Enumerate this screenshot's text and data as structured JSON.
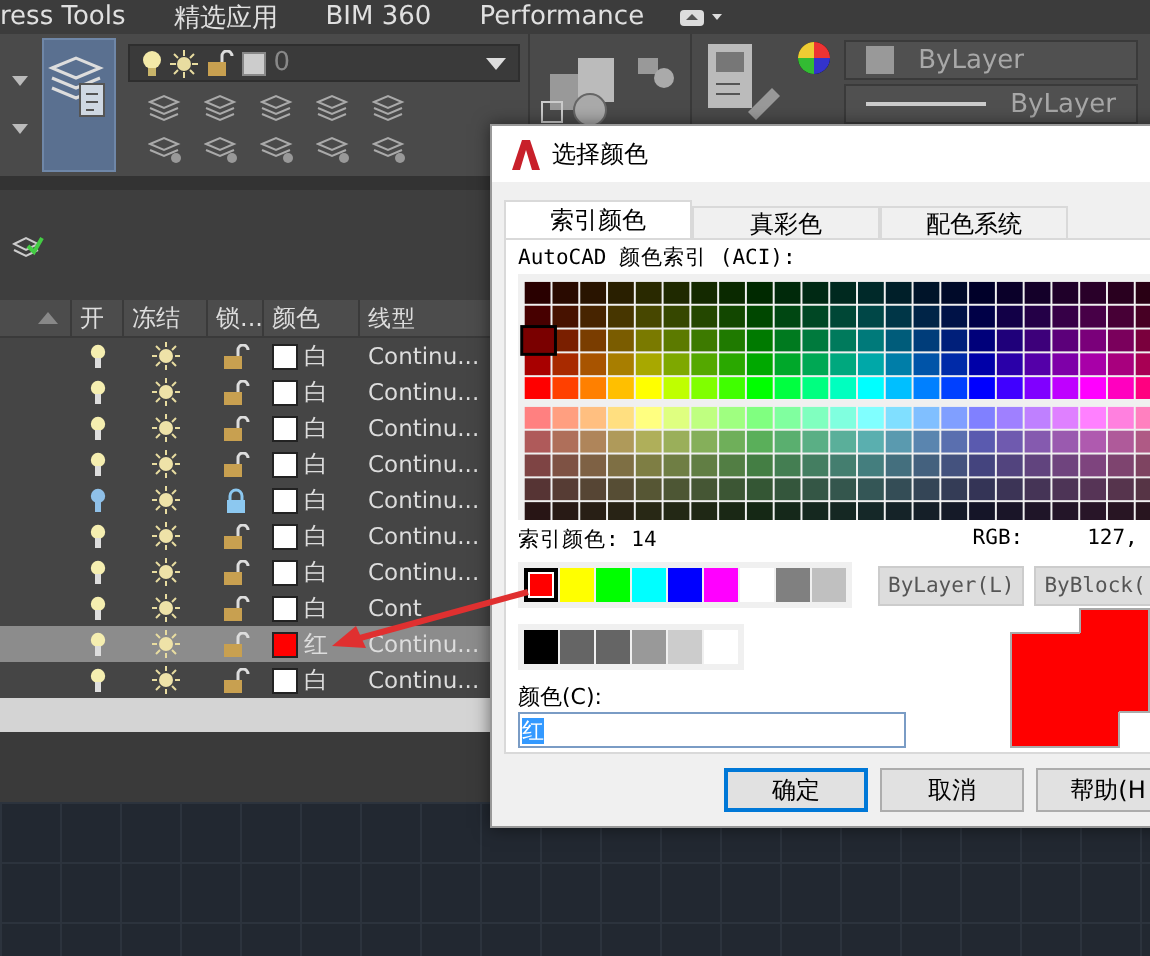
{
  "ribbon_tabs": [
    {
      "label": "ress Tools"
    },
    {
      "label": "精选应用"
    },
    {
      "label": "BIM 360"
    },
    {
      "label": "Performance"
    }
  ],
  "ribbon": {
    "layer_dropdown": {
      "value": "0"
    },
    "color_dropdown": {
      "value": "ByLayer"
    },
    "linetype_dropdown": {
      "value": "ByLayer"
    }
  },
  "layers_table": {
    "columns": [
      "开",
      "冻结",
      "锁...",
      "颜色",
      "线型"
    ],
    "rows": [
      {
        "on": true,
        "frozen": false,
        "locked": false,
        "color_name": "白",
        "color": "#ffffff",
        "linetype": "Continu...",
        "selected": false
      },
      {
        "on": true,
        "frozen": false,
        "locked": false,
        "color_name": "白",
        "color": "#ffffff",
        "linetype": "Continu...",
        "selected": false
      },
      {
        "on": true,
        "frozen": false,
        "locked": false,
        "color_name": "白",
        "color": "#ffffff",
        "linetype": "Continu...",
        "selected": false
      },
      {
        "on": true,
        "frozen": false,
        "locked": false,
        "color_name": "白",
        "color": "#ffffff",
        "linetype": "Continu...",
        "selected": false
      },
      {
        "on": false,
        "frozen": false,
        "locked": true,
        "color_name": "白",
        "color": "#ffffff",
        "linetype": "Continu...",
        "selected": false
      },
      {
        "on": true,
        "frozen": false,
        "locked": false,
        "color_name": "白",
        "color": "#ffffff",
        "linetype": "Continu...",
        "selected": false
      },
      {
        "on": true,
        "frozen": false,
        "locked": false,
        "color_name": "白",
        "color": "#ffffff",
        "linetype": "Continu...",
        "selected": false
      },
      {
        "on": true,
        "frozen": false,
        "locked": false,
        "color_name": "白",
        "color": "#ffffff",
        "linetype": "Cont",
        "selected": false
      },
      {
        "on": true,
        "frozen": false,
        "locked": false,
        "color_name": "红",
        "color": "#ff0000",
        "linetype": "Continu...",
        "selected": true
      },
      {
        "on": true,
        "frozen": false,
        "locked": false,
        "color_name": "白",
        "color": "#ffffff",
        "linetype": "Continu...",
        "selected": false
      }
    ]
  },
  "dialog": {
    "title": "选择颜色",
    "tabs": [
      {
        "label": "索引颜色",
        "selected": true
      },
      {
        "label": "真彩色",
        "selected": false
      },
      {
        "label": "配色系统",
        "selected": false
      }
    ],
    "aci_label": "AutoCAD 颜色索引 (ACI):",
    "index_label": "索引颜色: 14",
    "rgb_label": "RGB:",
    "rgb_value": "127,",
    "standard_colors": [
      {
        "color": "#ff0000",
        "selected": true
      },
      {
        "color": "#ffff00",
        "selected": false
      },
      {
        "color": "#00ff00",
        "selected": false
      },
      {
        "color": "#00ffff",
        "selected": false
      },
      {
        "color": "#0000ff",
        "selected": false
      },
      {
        "color": "#ff00ff",
        "selected": false
      },
      {
        "color": "#ffffff",
        "selected": false
      },
      {
        "color": "#808080",
        "selected": false
      },
      {
        "color": "#c0c0c0",
        "selected": false
      }
    ],
    "gray_colors": [
      {
        "color": "#000000",
        "selected": false
      },
      {
        "color": "#656565",
        "selected": false
      },
      {
        "color": "#656565",
        "selected": false
      },
      {
        "color": "#999999",
        "selected": false
      },
      {
        "color": "#cccccc",
        "selected": false
      },
      {
        "color": "#ffffff",
        "selected": false
      }
    ],
    "bylayer_button": "ByLayer(L)",
    "byblock_button": "ByBlock(",
    "color_field": {
      "label": "颜色(C):",
      "value": "红"
    },
    "preview_swatches": [
      {
        "color": "#ff0000"
      },
      {
        "color": "#ff0000"
      }
    ],
    "buttons": [
      {
        "label": "确定",
        "default": true
      },
      {
        "label": "取消",
        "default": false
      },
      {
        "label": "帮助(H",
        "default": false
      }
    ]
  }
}
